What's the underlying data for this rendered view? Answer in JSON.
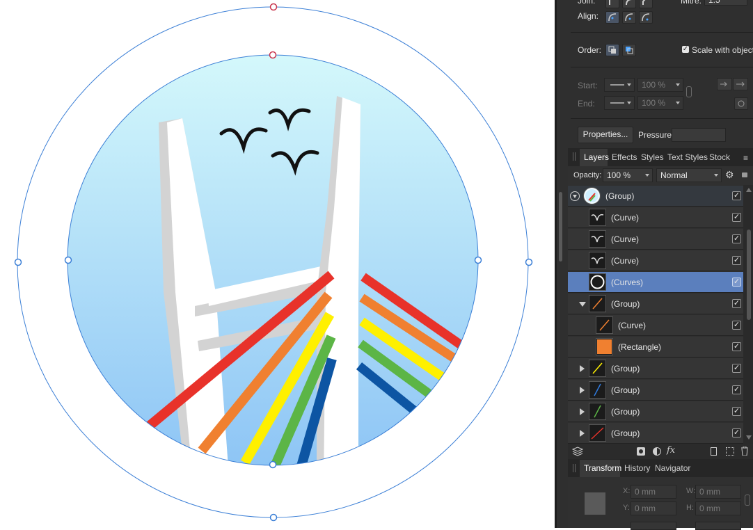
{
  "stroke": {
    "join_label": "Join:",
    "mitre_label": "Mitre:",
    "mitre_value": "1.5",
    "align_label": "Align:",
    "order_label": "Order:",
    "scale_with_object_label": "Scale with object",
    "scale_with_object_checked": true,
    "start_label": "Start:",
    "end_label": "End:",
    "start_percent": "100 %",
    "end_percent": "100 %",
    "properties_button": "Properties...",
    "pressure_label": "Pressure:"
  },
  "layers_panel": {
    "tabs": [
      "Layers",
      "Effects",
      "Styles",
      "Text Styles",
      "Stock"
    ],
    "active_tab": "Layers",
    "opacity_label": "Opacity:",
    "opacity_value": "100 %",
    "blend_mode": "Normal",
    "layers": [
      {
        "name": "(Group)",
        "thumb": "badge",
        "expander": "down",
        "checked": true,
        "selected": false
      },
      {
        "name": "(Curve)",
        "thumb": "bird",
        "expander": "",
        "checked": true,
        "selected": false
      },
      {
        "name": "(Curve)",
        "thumb": "bird",
        "expander": "",
        "checked": true,
        "selected": false
      },
      {
        "name": "(Curve)",
        "thumb": "bird",
        "expander": "",
        "checked": true,
        "selected": false
      },
      {
        "name": "(Curves)",
        "thumb": "ring",
        "expander": "",
        "checked": true,
        "selected": true
      },
      {
        "name": "(Group)",
        "thumb": "orange-line",
        "expander": "down",
        "checked": true,
        "selected": false
      },
      {
        "name": "(Curve)",
        "thumb": "orange-line",
        "expander": "",
        "checked": true,
        "selected": false
      },
      {
        "name": "(Rectangle)",
        "thumb": "orange-square",
        "expander": "",
        "checked": true,
        "selected": false
      },
      {
        "name": "(Group)",
        "thumb": "yellow-line",
        "expander": "right",
        "checked": true,
        "selected": false
      },
      {
        "name": "(Group)",
        "thumb": "blue-line",
        "expander": "right",
        "checked": true,
        "selected": false
      },
      {
        "name": "(Group)",
        "thumb": "green-line",
        "expander": "right",
        "checked": true,
        "selected": false
      },
      {
        "name": "(Group)",
        "thumb": "red-line",
        "expander": "right",
        "checked": true,
        "selected": false
      }
    ]
  },
  "transform_panel": {
    "tabs": [
      "Transform",
      "History",
      "Navigator"
    ],
    "active_tab": "Transform",
    "x_label": "X:",
    "x_value": "0 mm",
    "y_label": "Y:",
    "y_value": "0 mm",
    "w_label": "W:",
    "w_value": "0 mm",
    "h_label": "H:",
    "h_value": "0 mm"
  },
  "colors": {
    "panel_bg": "#2f2f2f",
    "selection_blue": "#5b7fbd",
    "bezier_outline": "#3b7fd6",
    "handle_red": "#c8324b",
    "sky_top": "#d4f8fb",
    "sky_bottom": "#8ec5f5",
    "rainbow": [
      "#e8322a",
      "#f08030",
      "#fff000",
      "#5cb546",
      "#0d55a3"
    ]
  }
}
